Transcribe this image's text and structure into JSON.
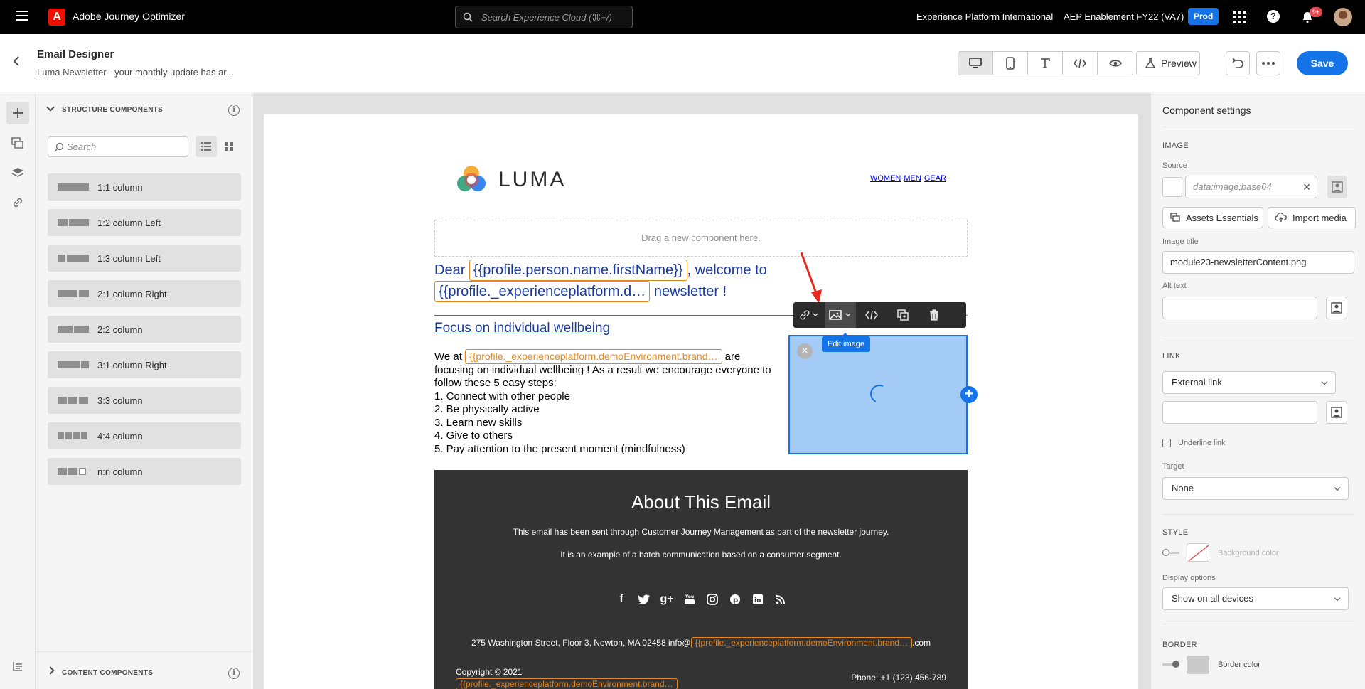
{
  "topbar": {
    "app_name": "Adobe Journey Optimizer",
    "logo_letter": "A",
    "search_placeholder": "Search Experience Cloud (⌘+/)",
    "org": "Experience Platform International",
    "sandbox": "AEP Enablement FY22 (VA7)",
    "env_badge": "Prod",
    "notification_count": "9+"
  },
  "header": {
    "title": "Email Designer",
    "subtitle": "Luma Newsletter - your monthly update has ar...",
    "preview_label": "Preview",
    "save_label": "Save"
  },
  "left_panel": {
    "structure_heading": "STRUCTURE COMPONENTS",
    "search_placeholder": "Search",
    "components": [
      {
        "label": "1:1 column"
      },
      {
        "label": "1:2 column Left"
      },
      {
        "label": "1:3 column Left"
      },
      {
        "label": "2:1 column Right"
      },
      {
        "label": "2:2 column"
      },
      {
        "label": "3:1 column Right"
      },
      {
        "label": "3:3 column"
      },
      {
        "label": "4:4 column"
      },
      {
        "label": "n:n column"
      }
    ],
    "content_heading": "CONTENT COMPONENTS"
  },
  "email": {
    "logo_text": "LUMA",
    "nav": [
      "WOMEN",
      "MEN",
      "GEAR"
    ],
    "drag_hint": "Drag a new component here.",
    "greeting_pre": "Dear ",
    "greeting_tag1": "{{profile.person.name.firstName}}",
    "greeting_mid": ", welcome to ",
    "greeting_tag2": "{{profile._experienceplatform.d…",
    "greeting_post": " newsletter !",
    "section_title": "Focus on individual wellbeing ",
    "body_pre": "We at ",
    "body_tag": "{{profile._experienceplatform.demoEnvironment.brand…",
    "body_post": " are focusing on individual wellbeing ! As a result we encourage everyone to follow these 5 easy steps:",
    "steps": [
      "1. Connect with other people",
      "2. Be physically active",
      "3. Learn new skills",
      "4. Give to others",
      "5. Pay attention to the present moment (mindfulness)"
    ],
    "tooltip": "Edit image",
    "footer": {
      "title": "About This Email",
      "p1": "This email has been sent through Customer Journey Management as part of the newsletter journey.",
      "p2": "It is an example of a batch communication based on a consumer segment.",
      "addr_pre": "275 Washington Street, Floor 3, Newton, MA 02458 info@",
      "addr_tag": "{{profile._experienceplatform.demoEnvironment.brand…",
      "addr_post": ".com",
      "copyright": "Copyright © 2021",
      "brand_tag": "{{profile._experienceplatform.demoEnvironment.brand…",
      "phone": "Phone: +1 (123) 456-789"
    }
  },
  "right_panel": {
    "title": "Component settings",
    "image_section": "IMAGE",
    "source_label": "Source",
    "source_placeholder": "data:image;base64",
    "assets_btn": "Assets Essentials",
    "import_btn": "Import media",
    "image_title_label": "Image title",
    "image_title_value": "module23-newsletterContent.png",
    "alt_text_label": "Alt text",
    "alt_text_value": "",
    "link_section": "LINK",
    "link_type": "External link",
    "link_value": "",
    "underline_label": "Underline link",
    "target_label": "Target",
    "target_value": "None",
    "style_section": "STYLE",
    "bg_color_label": "Background color",
    "display_label": "Display options",
    "display_value": "Show on all devices",
    "border_section": "BORDER",
    "border_color_label": "Border color"
  },
  "colors": {
    "accent": "#1473e6",
    "tag_orange": "#e68619",
    "topbar_bg": "#000000",
    "email_footer_bg": "#333333",
    "image_placeholder": "#a4cbf5"
  }
}
